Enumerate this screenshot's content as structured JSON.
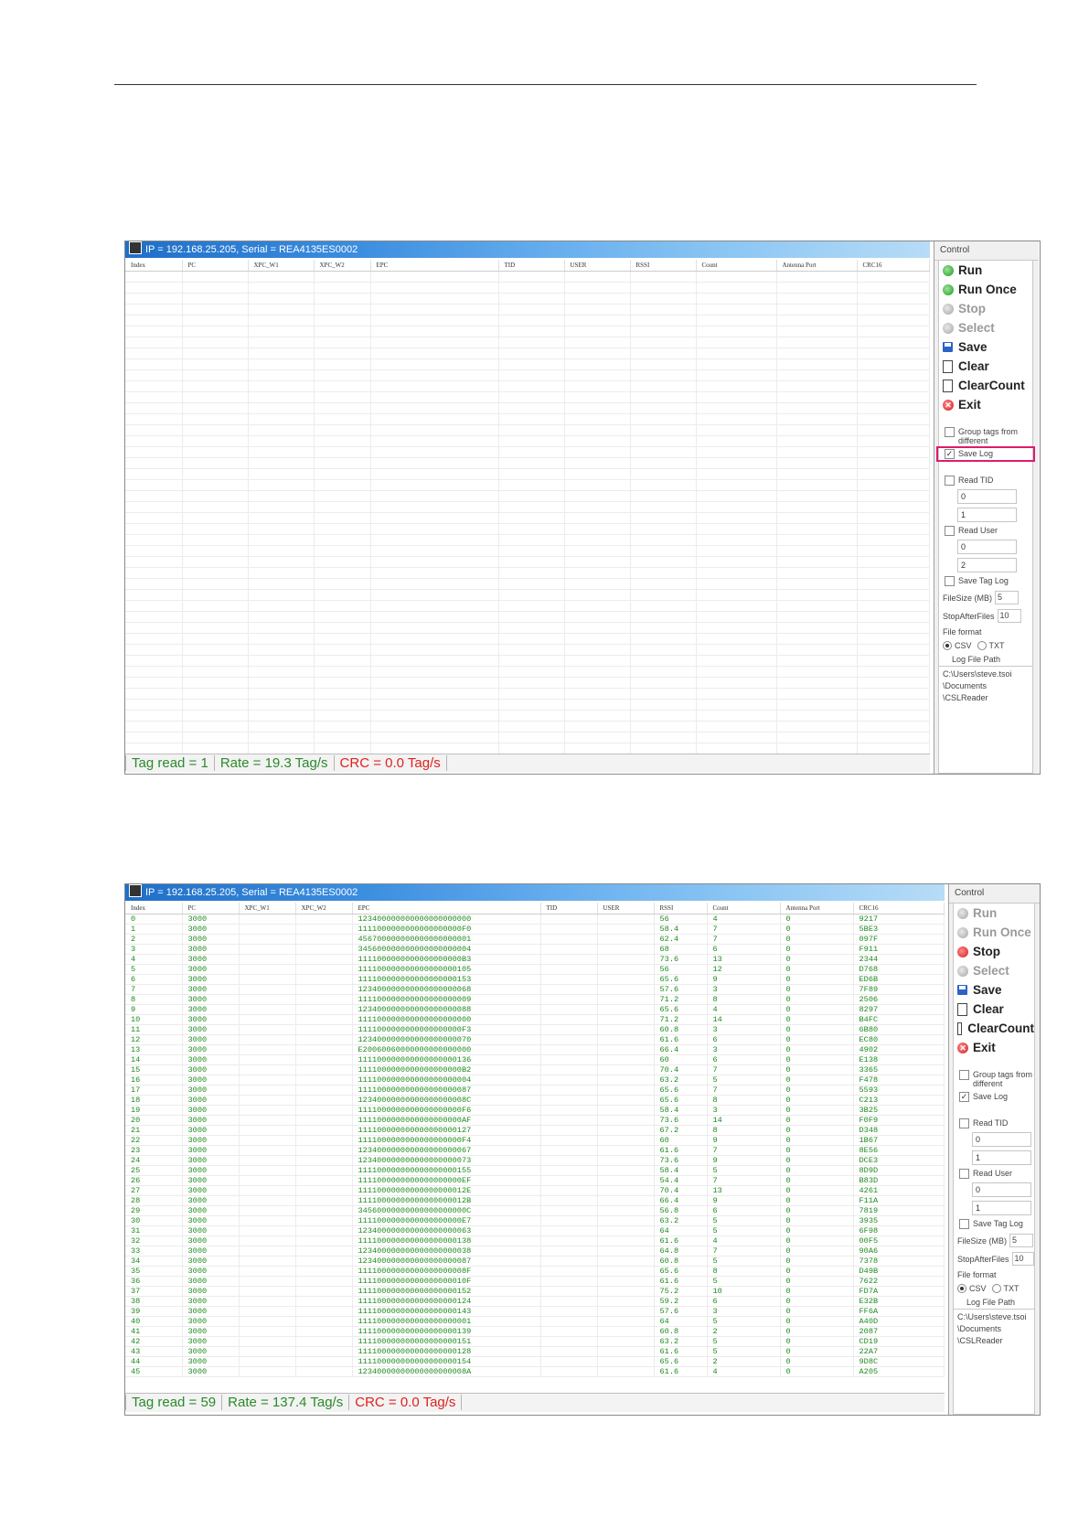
{
  "shot1": {
    "title": "IP = 192.168.25.205, Serial = REA4135ES0002",
    "columns": [
      "Index",
      "PC",
      "XPC_W1",
      "XPC_W2",
      "EPC",
      "TID",
      "USER",
      "RSSI",
      "Count",
      "Antenna Port",
      "CRC16"
    ],
    "status": {
      "tag_read": "Tag read = 1",
      "rate": "Rate = 19.3 Tag/s",
      "crc": "CRC = 0.0 Tag/s"
    },
    "panel": {
      "title": "Control",
      "buttons": [
        {
          "label": "Run",
          "icon": "green-circle-icon",
          "enabled": true
        },
        {
          "label": "Run Once",
          "icon": "green-circle-icon",
          "enabled": true
        },
        {
          "label": "Stop",
          "icon": "gray-circle-icon",
          "enabled": false
        },
        {
          "label": "Select",
          "icon": "gray-circle-icon",
          "enabled": false
        },
        {
          "label": "Save",
          "icon": "floppy-icon",
          "enabled": true
        },
        {
          "label": "Clear",
          "icon": "document-icon",
          "enabled": true
        },
        {
          "label": "ClearCount",
          "icon": "document-icon",
          "enabled": true
        },
        {
          "label": "Exit",
          "icon": "red-close-icon",
          "enabled": true
        }
      ],
      "group_tags": "Group tags from different",
      "save_log": "Save Log",
      "save_log_checked": true,
      "read_tid": "Read TID",
      "tid_values": [
        "0",
        "1"
      ],
      "read_user": "Read User",
      "user_values": [
        "0",
        "2"
      ],
      "save_tag_log": "Save Tag Log",
      "filesize_label": "FileSize (MB)",
      "filesize_value": "5",
      "stop_after_label": "StopAfterFiles",
      "stop_after_value": "10",
      "file_format_label": "File format",
      "csv": "CSV",
      "txt": "TXT",
      "log_path_label": "Log File Path",
      "log_path": [
        "C:\\Users\\steve.tsoi",
        "\\Documents",
        "\\CSLReader"
      ]
    }
  },
  "shot2": {
    "title": "IP = 192.168.25.205, Serial = REA4135ES0002",
    "columns": [
      "Index",
      "PC",
      "XPC_W1",
      "XPC_W2",
      "EPC",
      "TID",
      "USER",
      "RSSI",
      "Count",
      "Antenna Port",
      "CRC16"
    ],
    "rows": [
      [
        "0",
        "3000",
        "123400000000000000000000",
        "56",
        "4",
        "0",
        "9217"
      ],
      [
        "1",
        "3000",
        "1111000000000000000000F0",
        "58.4",
        "7",
        "0",
        "5BE3"
      ],
      [
        "2",
        "3000",
        "456700000000000000000001",
        "62.4",
        "7",
        "0",
        "097F"
      ],
      [
        "3",
        "3000",
        "345600000000000000000004",
        "68",
        "6",
        "0",
        "F911"
      ],
      [
        "4",
        "3000",
        "1111000000000000000000B3",
        "73.6",
        "13",
        "0",
        "2344"
      ],
      [
        "5",
        "3000",
        "111100000000000000000105",
        "56",
        "12",
        "0",
        "D768"
      ],
      [
        "6",
        "3000",
        "111100000000000000000153",
        "65.6",
        "9",
        "0",
        "ED6B"
      ],
      [
        "7",
        "3000",
        "123400000000000000000068",
        "57.6",
        "3",
        "0",
        "7F89"
      ],
      [
        "8",
        "3000",
        "111100000000000000000009",
        "71.2",
        "8",
        "0",
        "2506"
      ],
      [
        "9",
        "3000",
        "123400000000000000000088",
        "65.6",
        "4",
        "0",
        "8297"
      ],
      [
        "10",
        "3000",
        "111100000000000000000000",
        "71.2",
        "14",
        "0",
        "B4FC"
      ],
      [
        "11",
        "3000",
        "1111000000000000000000F3",
        "60.8",
        "3",
        "0",
        "6B80"
      ],
      [
        "12",
        "3000",
        "123400000000000000000070",
        "61.6",
        "6",
        "0",
        "EC80"
      ],
      [
        "13",
        "3000",
        "E20060060000000000000000",
        "66.4",
        "3",
        "0",
        "4902"
      ],
      [
        "14",
        "3000",
        "111100000000000000000136",
        "60",
        "6",
        "0",
        "E138"
      ],
      [
        "15",
        "3000",
        "1111000000000000000000B2",
        "70.4",
        "7",
        "0",
        "3365"
      ],
      [
        "16",
        "3000",
        "111100000000000000000004",
        "63.2",
        "5",
        "0",
        "F478"
      ],
      [
        "17",
        "3000",
        "111100000000000000000087",
        "65.6",
        "7",
        "0",
        "5593"
      ],
      [
        "18",
        "3000",
        "12340000000000000000008C",
        "65.6",
        "8",
        "0",
        "C213"
      ],
      [
        "19",
        "3000",
        "1111000000000000000000F6",
        "58.4",
        "3",
        "0",
        "3B25"
      ],
      [
        "20",
        "3000",
        "1111000000000000000000AF",
        "73.6",
        "14",
        "0",
        "F0F9"
      ],
      [
        "21",
        "3000",
        "111100000000000000000127",
        "67.2",
        "8",
        "0",
        "D348"
      ],
      [
        "22",
        "3000",
        "1111000000000000000000F4",
        "60",
        "9",
        "0",
        "1B67"
      ],
      [
        "23",
        "3000",
        "123400000000000000000067",
        "61.6",
        "7",
        "0",
        "8E56"
      ],
      [
        "24",
        "3000",
        "123400000000000000000073",
        "73.6",
        "9",
        "0",
        "DCE3"
      ],
      [
        "25",
        "3000",
        "111100000000000000000155",
        "58.4",
        "5",
        "0",
        "8D9D"
      ],
      [
        "26",
        "3000",
        "1111000000000000000000EF",
        "54.4",
        "7",
        "0",
        "B83D"
      ],
      [
        "27",
        "3000",
        "11110000000000000000012E",
        "70.4",
        "13",
        "0",
        "4261"
      ],
      [
        "28",
        "3000",
        "11110000000000000000012B",
        "66.4",
        "9",
        "0",
        "F11A"
      ],
      [
        "29",
        "3000",
        "34560000000000000000000C",
        "56.8",
        "6",
        "0",
        "7819"
      ],
      [
        "30",
        "3000",
        "1111000000000000000000E7",
        "63.2",
        "5",
        "0",
        "3935"
      ],
      [
        "31",
        "3000",
        "123400000000000000000063",
        "64",
        "5",
        "0",
        "6F98"
      ],
      [
        "32",
        "3000",
        "111100000000000000000138",
        "61.6",
        "4",
        "0",
        "00F5"
      ],
      [
        "33",
        "3000",
        "123400000000000000000038",
        "64.8",
        "7",
        "0",
        "90A6"
      ],
      [
        "34",
        "3000",
        "123400000000000000000087",
        "60.8",
        "5",
        "0",
        "7378"
      ],
      [
        "35",
        "3000",
        "11110000000000000000008F",
        "65.6",
        "8",
        "0",
        "D49B"
      ],
      [
        "36",
        "3000",
        "11110000000000000000010F",
        "61.6",
        "5",
        "0",
        "7622"
      ],
      [
        "37",
        "3000",
        "111100000000000000000152",
        "75.2",
        "10",
        "0",
        "FD7A"
      ],
      [
        "38",
        "3000",
        "111100000000000000000124",
        "59.2",
        "6",
        "0",
        "E32B"
      ],
      [
        "39",
        "3000",
        "111100000000000000000143",
        "57.6",
        "3",
        "0",
        "FF6A"
      ],
      [
        "40",
        "3000",
        "111100000000000000000001",
        "64",
        "5",
        "0",
        "A40D"
      ],
      [
        "41",
        "3000",
        "111100000000000000000139",
        "60.8",
        "2",
        "0",
        "2087"
      ],
      [
        "42",
        "3000",
        "111100000000000000000151",
        "63.2",
        "5",
        "0",
        "CD19"
      ],
      [
        "43",
        "3000",
        "111100000000000000000128",
        "61.6",
        "5",
        "0",
        "22A7"
      ],
      [
        "44",
        "3000",
        "111100000000000000000154",
        "65.6",
        "2",
        "0",
        "9D8C"
      ],
      [
        "45",
        "3000",
        "12340000000000000000008A",
        "61.6",
        "4",
        "0",
        "A205"
      ]
    ],
    "status": {
      "tag_read": "Tag read = 59",
      "rate": "Rate = 137.4 Tag/s",
      "crc": "CRC = 0.0 Tag/s"
    },
    "panel": {
      "title": "Control",
      "buttons": [
        {
          "label": "Run",
          "icon": "gray-circle-icon",
          "enabled": false
        },
        {
          "label": "Run Once",
          "icon": "gray-circle-icon",
          "enabled": false
        },
        {
          "label": "Stop",
          "icon": "red-circle-icon",
          "enabled": true
        },
        {
          "label": "Select",
          "icon": "gray-circle-icon",
          "enabled": false
        },
        {
          "label": "Save",
          "icon": "floppy-icon",
          "enabled": true
        },
        {
          "label": "Clear",
          "icon": "document-icon",
          "enabled": true
        },
        {
          "label": "ClearCount",
          "icon": "document-icon",
          "enabled": true
        },
        {
          "label": "Exit",
          "icon": "red-close-icon",
          "enabled": true
        }
      ],
      "group_tags": "Group tags from different",
      "save_log": "Save Log",
      "save_log_checked": true,
      "read_tid": "Read TID",
      "tid_values": [
        "0",
        "1"
      ],
      "read_user": "Read User",
      "user_values": [
        "0",
        "1"
      ],
      "save_tag_log": "Save Tag Log",
      "filesize_label": "FileSize (MB)",
      "filesize_value": "5",
      "stop_after_label": "StopAfterFiles",
      "stop_after_value": "10",
      "file_format_label": "File format",
      "csv": "CSV",
      "txt": "TXT",
      "log_path_label": "Log File Path",
      "log_path": [
        "C:\\Users\\steve.tsoi",
        "\\Documents",
        "\\CSLReader"
      ]
    }
  }
}
